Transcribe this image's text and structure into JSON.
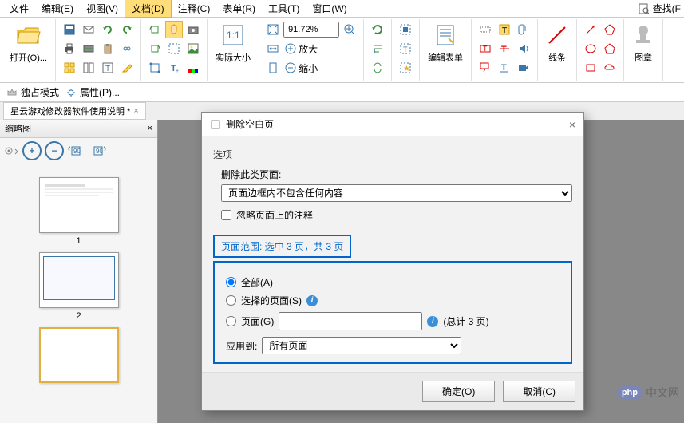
{
  "menu": {
    "file": "文件",
    "edit": "编辑(E)",
    "view": "视图(V)",
    "document": "文档(D)",
    "comment": "注释(C)",
    "form": "表单(R)",
    "tool": "工具(T)",
    "window": "窗口(W)",
    "find": "查找(F"
  },
  "ribbon": {
    "open": "打开(O)...",
    "actual_size": "实际大小",
    "zoom_in": "放大",
    "zoom_out": "缩小",
    "zoom_value": "91.72%",
    "edit_form": "编辑表单",
    "lines": "线条",
    "stamp": "图章"
  },
  "subbar": {
    "exclusive": "独占模式",
    "properties": "属性(P)..."
  },
  "document_tab": "星云游戏修改器软件使用说明 *",
  "thumbnails": {
    "title": "缩略图",
    "pages": [
      "1",
      "2"
    ]
  },
  "dialog": {
    "title": "删除空白页",
    "section_options": "选项",
    "delete_label": "删除此类页面:",
    "delete_option": "页面边框内不包含任何内容",
    "ignore_annotations": "忽略页面上的注释",
    "range_header": "页面范围: 选中 3 页，共 3 页",
    "radio_all": "全部(A)",
    "radio_selected": "选择的页面(S)",
    "radio_pages": "页面(G)",
    "total_pages": "(总计 3 页)",
    "apply_to_label": "应用到:",
    "apply_to_value": "所有页面",
    "ok": "确定(O)",
    "cancel": "取消(C)"
  },
  "watermark": "中文网"
}
